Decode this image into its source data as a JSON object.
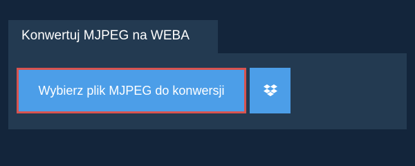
{
  "tab": {
    "title": "Konwertuj MJPEG na WEBA"
  },
  "upload": {
    "choose_label": "Wybierz plik MJPEG do konwersji",
    "dropbox_icon": "dropbox-icon"
  },
  "colors": {
    "background": "#13253b",
    "panel": "#233a51",
    "button": "#4c9ee8",
    "focus_border": "#d9534f",
    "text": "#ffffff"
  }
}
